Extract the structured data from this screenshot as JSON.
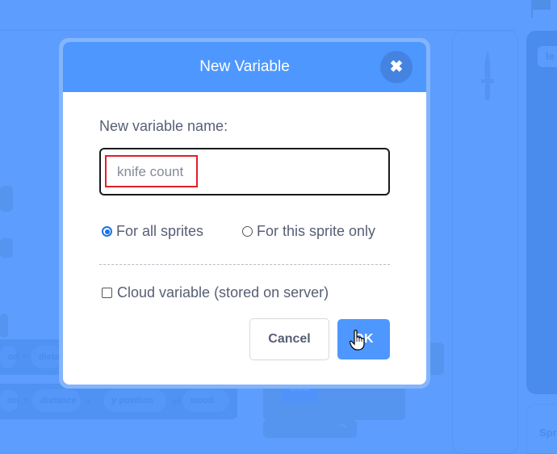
{
  "dialog": {
    "title": "New Variable",
    "close_icon": "close-icon",
    "name_label": "New variable name:",
    "name_value": "knife count",
    "scope_options": [
      {
        "label": "For all sprites",
        "checked": true
      },
      {
        "label": "For this sprite only",
        "checked": false
      }
    ],
    "cloud_label": "Cloud variable (stored on server)",
    "cloud_checked": false,
    "cancel_label": "Cancel",
    "ok_label": "OK"
  },
  "background": {
    "blocks_row1": [
      "on",
      "*",
      "distan"
    ],
    "blocks_row2": [
      "on",
      "*",
      "distance",
      "+",
      "y position",
      "of",
      "wood"
    ],
    "show_block": "show",
    "right_chip": "le",
    "sprite_label": "Spri"
  },
  "colors": {
    "accent": "#4d97ff",
    "overlay": "#5d9dfd",
    "highlight": "#e0202a",
    "text": "#575e75"
  }
}
